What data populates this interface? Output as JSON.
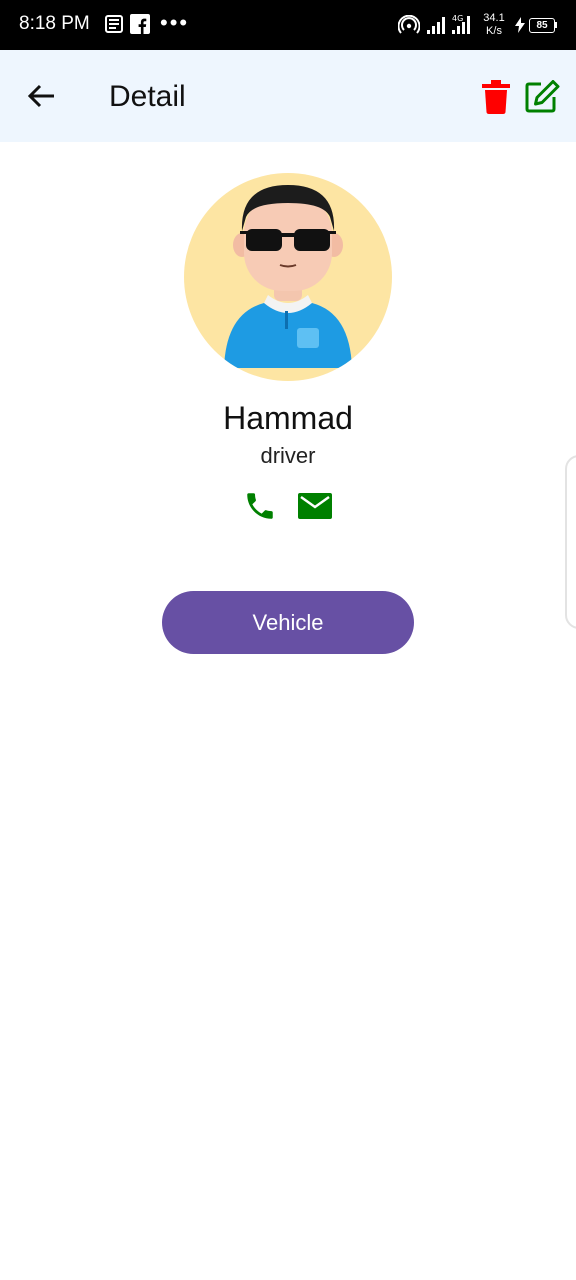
{
  "status_bar": {
    "time": "8:18 PM",
    "dots": "•••",
    "net_speed_value": "34.1",
    "net_speed_unit": "K/s",
    "battery": "85",
    "icons": [
      "news-icon",
      "facebook-icon",
      "hotspot-icon",
      "signal-icon",
      "4g-signal-icon",
      "charging-icon",
      "battery-icon"
    ]
  },
  "app_bar": {
    "title": "Detail",
    "back_icon": "arrow-left-icon",
    "delete_icon": "trash-icon",
    "edit_icon": "edit-icon",
    "background": "#eef6fe",
    "delete_color": "#ff0000",
    "edit_color": "#008000"
  },
  "profile": {
    "name": "Hammad",
    "role": "driver",
    "avatar_background": "#fde5a3",
    "contact_icons": [
      "phone-icon",
      "mail-icon"
    ],
    "contact_color": "#008000"
  },
  "actions": {
    "vehicle_label": "Vehicle",
    "vehicle_color": "#6750a4"
  }
}
